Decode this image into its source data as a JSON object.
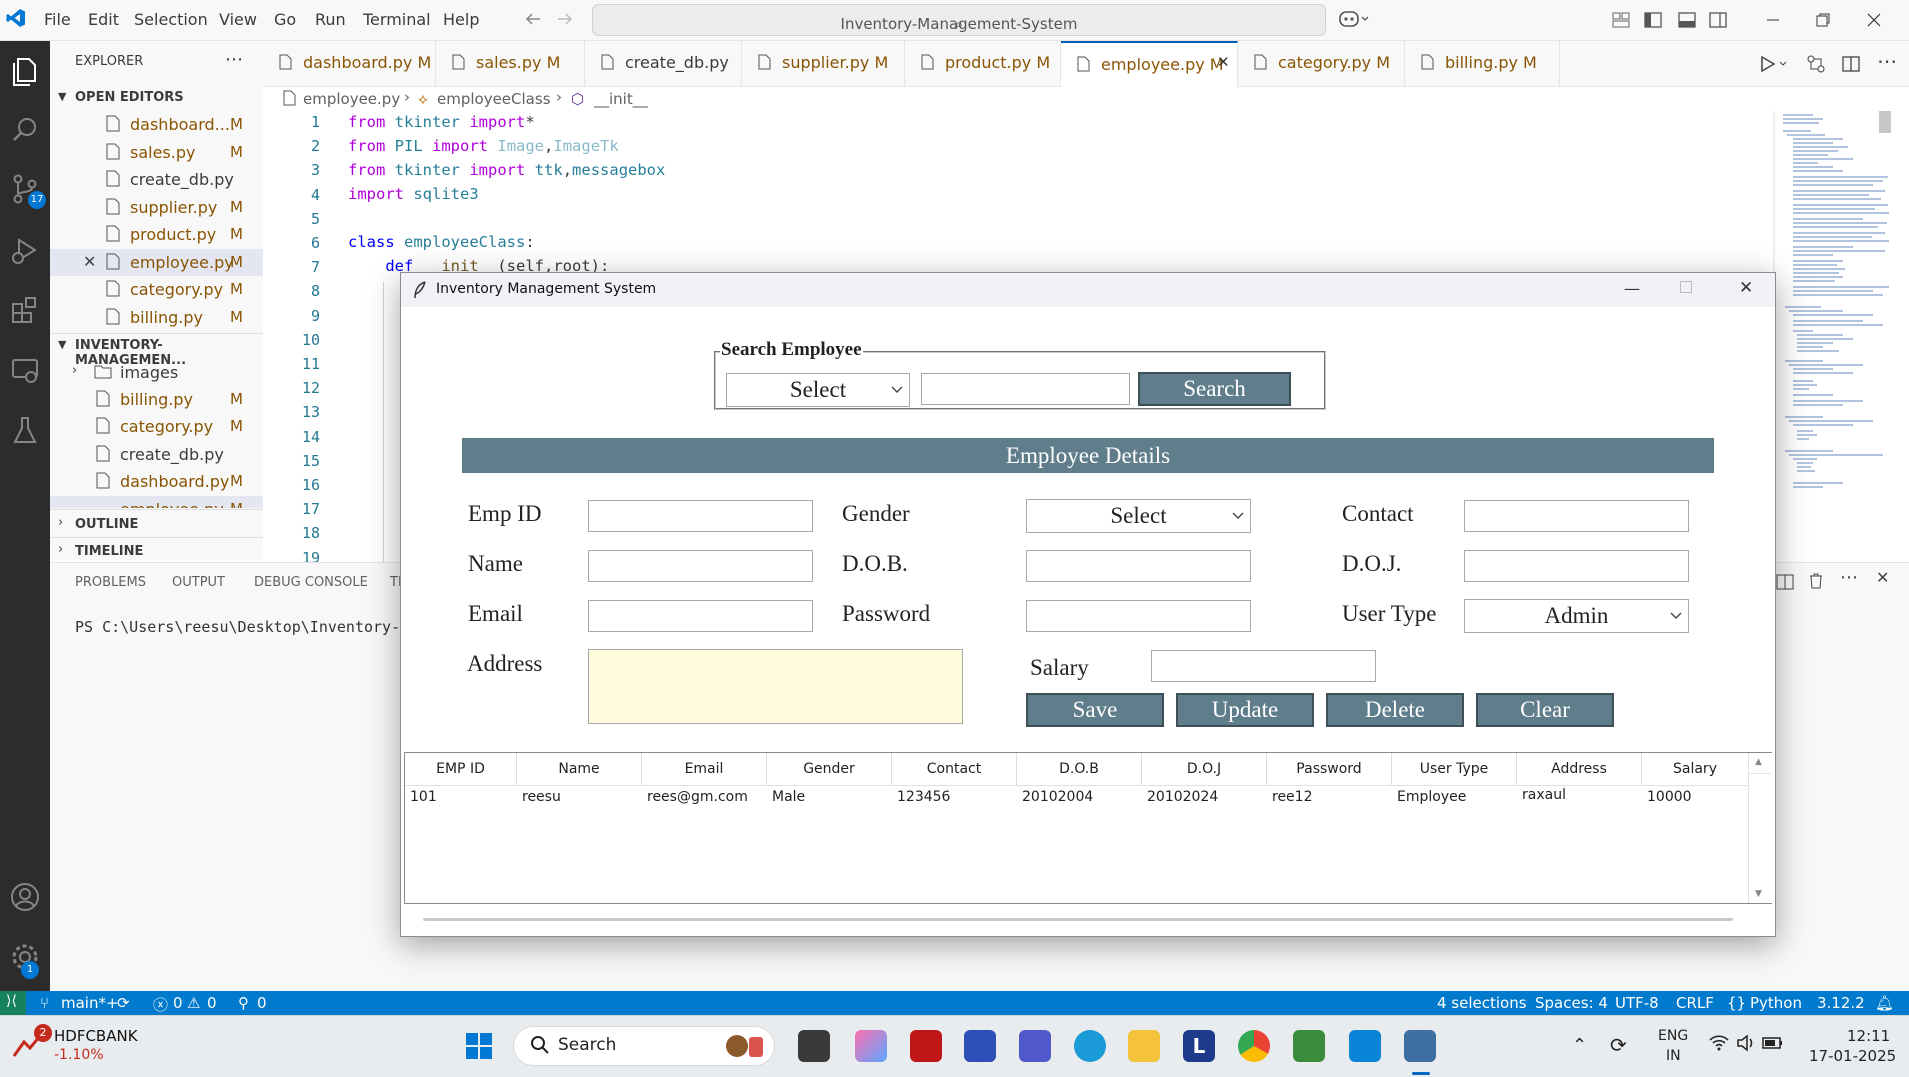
{
  "menu": [
    "File",
    "Edit",
    "Selection",
    "View",
    "Go",
    "Run",
    "Terminal",
    "Help"
  ],
  "command_center": "Inventory-Management-System",
  "activity_badges": {
    "source_control": "17",
    "accounts": "1"
  },
  "sidebar": {
    "explorer_title": "EXPLORER",
    "open_editors_title": "OPEN EDITORS",
    "open_editors": [
      {
        "name": "dashboard....",
        "mod": "M"
      },
      {
        "name": "sales.py",
        "mod": "M"
      },
      {
        "name": "create_db.py",
        "mod": ""
      },
      {
        "name": "supplier.py",
        "mod": "M"
      },
      {
        "name": "product.py",
        "mod": "M"
      },
      {
        "name": "employee.py",
        "mod": "M"
      },
      {
        "name": "category.py",
        "mod": "M"
      },
      {
        "name": "billing.py",
        "mod": "M"
      }
    ],
    "project_title": "INVENTORY-MANAGEMEN...",
    "project_items": [
      {
        "name": "images",
        "mod": ""
      },
      {
        "name": "billing.py",
        "mod": "M"
      },
      {
        "name": "category.py",
        "mod": "M"
      },
      {
        "name": "create_db.py",
        "mod": ""
      },
      {
        "name": "dashboard.py",
        "mod": "M"
      },
      {
        "name": "employee.py",
        "mod": "M"
      }
    ],
    "outline_title": "OUTLINE",
    "timeline_title": "TIMELINE"
  },
  "tabs": [
    {
      "label": "dashboard.py",
      "mod": "M"
    },
    {
      "label": "sales.py",
      "mod": "M"
    },
    {
      "label": "create_db.py",
      "mod": ""
    },
    {
      "label": "supplier.py",
      "mod": "M"
    },
    {
      "label": "product.py",
      "mod": "M"
    },
    {
      "label": "employee.py",
      "mod": "M"
    },
    {
      "label": "category.py",
      "mod": "M"
    },
    {
      "label": "billing.py",
      "mod": "M"
    }
  ],
  "breadcrumb": {
    "file": "employee.py",
    "class": "employeeClass",
    "method": "__init__"
  },
  "line_numbers": [
    "1",
    "2",
    "3",
    "4",
    "5",
    "6",
    "7",
    "8",
    "9",
    "10",
    "11",
    "12",
    "13",
    "14",
    "15",
    "16",
    "17",
    "18",
    "19"
  ],
  "panel": {
    "tabs": [
      "PROBLEMS",
      "OUTPUT",
      "DEBUG CONSOLE",
      "TI"
    ],
    "terminal_line": "PS C:\\Users\\reesu\\Desktop\\Inventory-"
  },
  "statusbar": {
    "branch": "main*+",
    "errors": "0",
    "warnings": "0",
    "ports": "0",
    "selections": "4 selections",
    "spaces": "Spaces: 4",
    "encoding": "UTF-8",
    "eol": "CRLF",
    "language": "Python",
    "version": "3.12.2"
  },
  "taskbar": {
    "stock_name": "HDFCBANK",
    "stock_change": "-1.10%",
    "stock_badge": "2",
    "search_placeholder": "Search",
    "lang_line1": "ENG",
    "lang_line2": "IN",
    "time": "12:11",
    "date": "17-01-2025"
  },
  "app": {
    "window_title": "Inventory Management System",
    "search_frame_title": "Search Employee",
    "search_select": "Select",
    "search_button": "Search",
    "details_header": "Employee Details",
    "labels": {
      "emp_id": "Emp ID",
      "gender": "Gender",
      "contact": "Contact",
      "name": "Name",
      "dob": "D.O.B.",
      "doj": "D.O.J.",
      "email": "Email",
      "password": "Password",
      "user_type": "User Type",
      "address": "Address",
      "salary": "Salary"
    },
    "gender_value": "Select",
    "user_type_value": "Admin",
    "buttons": {
      "save": "Save",
      "update": "Update",
      "delete": "Delete",
      "clear": "Clear"
    },
    "table": {
      "columns": [
        "EMP ID",
        "Name",
        "Email",
        "Gender",
        "Contact",
        "D.O.B",
        "D.O.J",
        "Password",
        "User Type",
        "Address",
        "Salary"
      ],
      "rows": [
        [
          "101",
          "reesu",
          "rees@gm.com",
          "Male",
          "123456",
          "20102004",
          "20102024",
          "ree12",
          "Employee",
          "raxaul",
          "10000"
        ]
      ]
    }
  },
  "colors": {
    "accent": "#007acc",
    "tk_button": "#607d8b",
    "address_bg": "#fffdde"
  }
}
